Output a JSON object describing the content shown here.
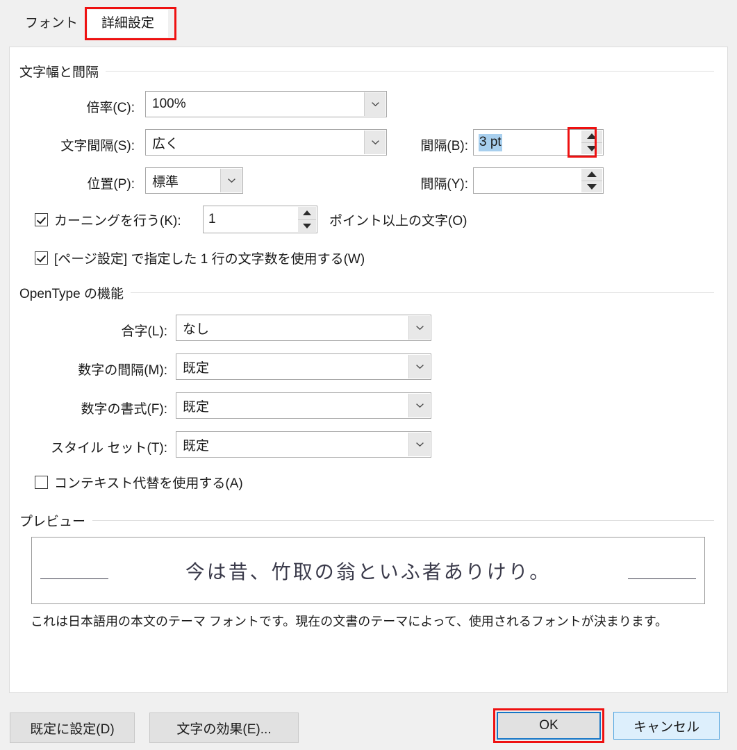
{
  "dialog": {
    "title": "フォント",
    "tabs": [
      {
        "label": "フォント",
        "selected": false
      },
      {
        "label": "詳細設定",
        "selected": true
      }
    ]
  },
  "char_spacing_group": {
    "title": "文字幅と間隔",
    "scale": {
      "label": "倍率(C):",
      "value": "100%"
    },
    "spacing": {
      "label": "文字間隔(S):",
      "value": "広く"
    },
    "position": {
      "label": "位置(P):",
      "value": "標準"
    },
    "spacing_by": {
      "label": "間隔(B):",
      "value": "3 pt",
      "selected": true
    },
    "position_by": {
      "label": "間隔(Y):",
      "value": ""
    },
    "kerning": {
      "checkbox_label": "カーニングを行う(K):",
      "checked": true,
      "value": "1",
      "suffix_label": "ポイント以上の文字(O)"
    },
    "use_grid": {
      "label": "[ページ設定] で指定した 1 行の文字数を使用する(W)",
      "checked": true
    }
  },
  "opentype_group": {
    "title": "OpenType の機能",
    "ligatures": {
      "label": "合字(L):",
      "value": "なし"
    },
    "number_spacing": {
      "label": "数字の間隔(M):",
      "value": "既定"
    },
    "number_forms": {
      "label": "数字の書式(F):",
      "value": "既定"
    },
    "stylistic_sets": {
      "label": "スタイル セット(T):",
      "value": "既定"
    },
    "contextual_alternates": {
      "label": "コンテキスト代替を使用する(A)",
      "checked": false
    }
  },
  "preview_group": {
    "title": "プレビュー",
    "sample_text": "今は昔、竹取の翁といふ者ありけり。",
    "note": "これは日本語用の本文のテーマ フォントです。現在の文書のテーマによって、使用されるフォントが決まります。"
  },
  "footer": {
    "set_default": "既定に設定(D)",
    "text_effects": "文字の効果(E)...",
    "ok": "OK",
    "cancel": "キャンセル"
  },
  "colors": {
    "annotation_red": "#ee1111",
    "focus_blue": "#1575c6",
    "selection_blue": "#a8cfee",
    "panel_bg": "#ffffff",
    "dialog_bg": "#f0f0f0"
  }
}
